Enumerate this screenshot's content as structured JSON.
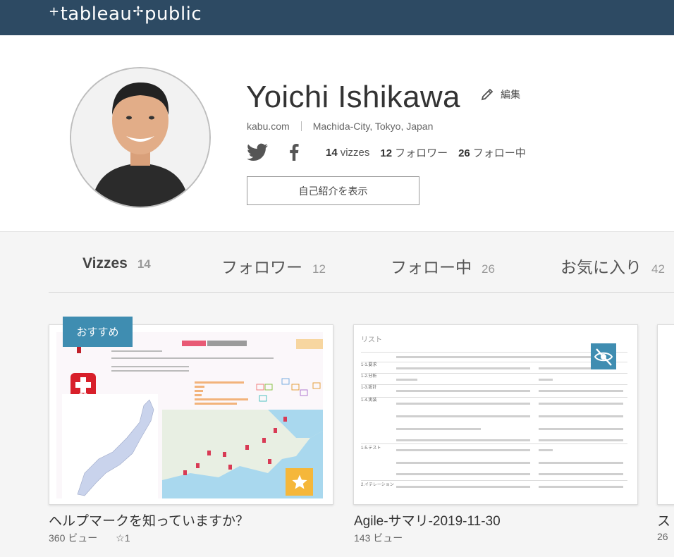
{
  "header": {
    "logo_left": "tableau",
    "logo_right": "public",
    "brand_color": "#2d4a63"
  },
  "profile": {
    "name": "Yoichi Ishikawa",
    "edit_label": "編集",
    "website": "kabu.com",
    "location": "Machida-City, Tokyo, Japan",
    "stats": {
      "vizzes_count": "14",
      "vizzes_label": "vizzes",
      "followers_count": "12",
      "followers_label": "フォロワー",
      "following_count": "26",
      "following_label": "フォロー中"
    },
    "bio_button": "自己紹介を表示",
    "social_icons": [
      "twitter-icon",
      "facebook-icon"
    ]
  },
  "tabs": [
    {
      "label": "Vizzes",
      "count": "14",
      "active": true
    },
    {
      "label": "フォロワー",
      "count": "12",
      "active": false
    },
    {
      "label": "フォロー中",
      "count": "26",
      "active": false
    },
    {
      "label": "お気に入り",
      "count": "42",
      "active": false
    }
  ],
  "cards": [
    {
      "badge": "おすすめ",
      "title": "ヘルプマークを知っていますか？",
      "views": "360 ビュー",
      "favorites": "☆1",
      "thumb_heading": "ヘルプマーク",
      "thumb_note": "Viz作成者を\nおんぐーです"
    },
    {
      "title": "Agile-サマリ-2019-11-30",
      "views": "143 ビュー",
      "thumb_heading": "リスト",
      "thumb_rows": [
        "1-1.要求",
        "1-2.分析",
        "1-3.設計",
        "1-4.実装",
        "1-5.テスト",
        "2.イテレーション"
      ]
    },
    {
      "title": "ス",
      "views": "26"
    }
  ],
  "colors": {
    "accent": "#3f8db1",
    "star": "#f5b73a"
  }
}
